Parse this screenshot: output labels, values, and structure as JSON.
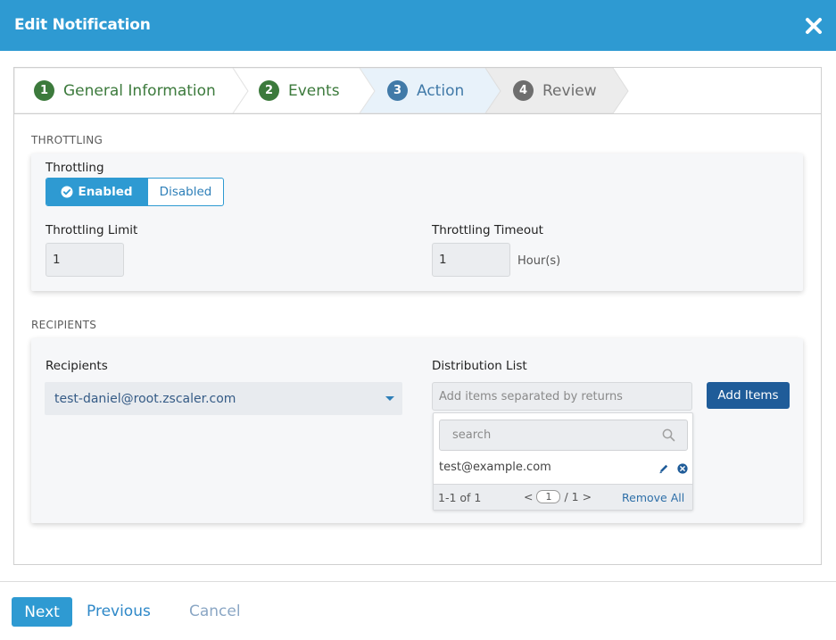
{
  "header": {
    "title": "Edit Notification"
  },
  "wizard": {
    "steps": [
      {
        "num": "1",
        "label": "General Information",
        "state": "done"
      },
      {
        "num": "2",
        "label": "Events",
        "state": "done"
      },
      {
        "num": "3",
        "label": "Action",
        "state": "current"
      },
      {
        "num": "4",
        "label": "Review",
        "state": "todo"
      }
    ]
  },
  "throttling": {
    "section_title": "THROTTLING",
    "toggle_label": "Throttling",
    "enabled_label": "Enabled",
    "disabled_label": "Disabled",
    "selected": "Enabled",
    "limit_label": "Throttling Limit",
    "limit_value": "1",
    "timeout_label": "Throttling Timeout",
    "timeout_value": "1",
    "timeout_unit": "Hour(s)"
  },
  "recipients": {
    "section_title": "RECIPIENTS",
    "recipients_label": "Recipients",
    "recipients_value": "test-daniel@root.zscaler.com",
    "distribution_label": "Distribution List",
    "distribution_placeholder": "Add items separated by returns",
    "add_items_label": "Add Items",
    "search_placeholder": "search",
    "items": [
      "test@example.com"
    ],
    "count_text": "1-1 of 1",
    "page_prev": "<",
    "page_current": "1",
    "page_total": "/ 1",
    "page_next": ">",
    "remove_all_label": "Remove All"
  },
  "footer": {
    "next_label": "Next",
    "previous_label": "Previous",
    "cancel_label": "Cancel"
  },
  "colors": {
    "header": "#2e9ad2",
    "step_done": "#3c7a3c",
    "step_current": "#417aa8",
    "step_todo": "#6e6e6e",
    "primary_button": "#2e9ad2",
    "add_button": "#1f5c99"
  }
}
